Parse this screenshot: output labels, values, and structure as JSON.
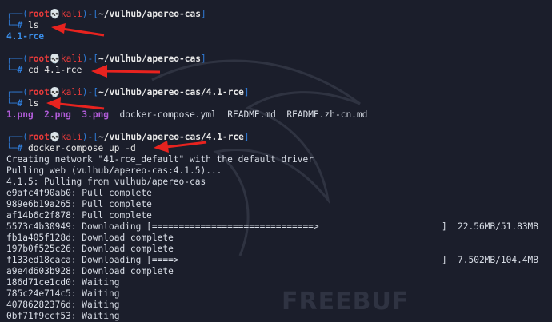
{
  "prompt": {
    "user": "root",
    "host": "kali",
    "skull": "💀"
  },
  "blocks": [
    {
      "path": "~/vulhub/apereo-cas",
      "command": "ls",
      "arg": ""
    },
    {
      "path": "~/vulhub/apereo-cas",
      "command": "cd",
      "arg": "4.1-rce"
    },
    {
      "path": "~/vulhub/apereo-cas/4.1-rce",
      "command": "ls",
      "arg": ""
    },
    {
      "path": "~/vulhub/apereo-cas/4.1-rce",
      "command": "docker-compose",
      "arg": "up -d"
    }
  ],
  "ls_output_1": "4.1-rce",
  "ls_output_2": {
    "pngs": [
      "1.png",
      "2.png",
      "3.png"
    ],
    "files": [
      "docker-compose.yml",
      "README.md",
      "README.zh-cn.md"
    ]
  },
  "docker_output": [
    "Creating network \"41-rce_default\" with the default driver",
    "Pulling web (vulhub/apereo-cas:4.1.5)...",
    "4.1.5: Pulling from vulhub/apereo-cas",
    "e9afc4f90ab0: Pull complete",
    "989e6b19a265: Pull complete",
    "af14b6c2f878: Pull complete"
  ],
  "downloading_1": {
    "layer": "5573c4b30949: Downloading [",
    "bar": "==============================>",
    "close": "]",
    "size": "22.56MB/51.83MB"
  },
  "docker_output_2": [
    "fb1a405f128d: Download complete",
    "197b0f525c26: Download complete"
  ],
  "downloading_2": {
    "layer": "f133ed18caca: Downloading [",
    "bar": "====>",
    "close": "]",
    "size": "7.502MB/104.4MB"
  },
  "docker_output_3": [
    "a9e4d603b928: Download complete",
    "186d71ce1cd0: Waiting",
    "785c24e714c5: Waiting",
    "40786282376d: Waiting",
    "0bf71f9ccf53: Waiting"
  ],
  "watermark": "FREEBUF",
  "colors": {
    "background": "#1b1e2b",
    "prompt_box": "#2f7bd6",
    "user": "#e53a3a",
    "dir": "#3b8ee8",
    "png": "#b05cd8",
    "annotation_arrow": "#e8231f"
  }
}
